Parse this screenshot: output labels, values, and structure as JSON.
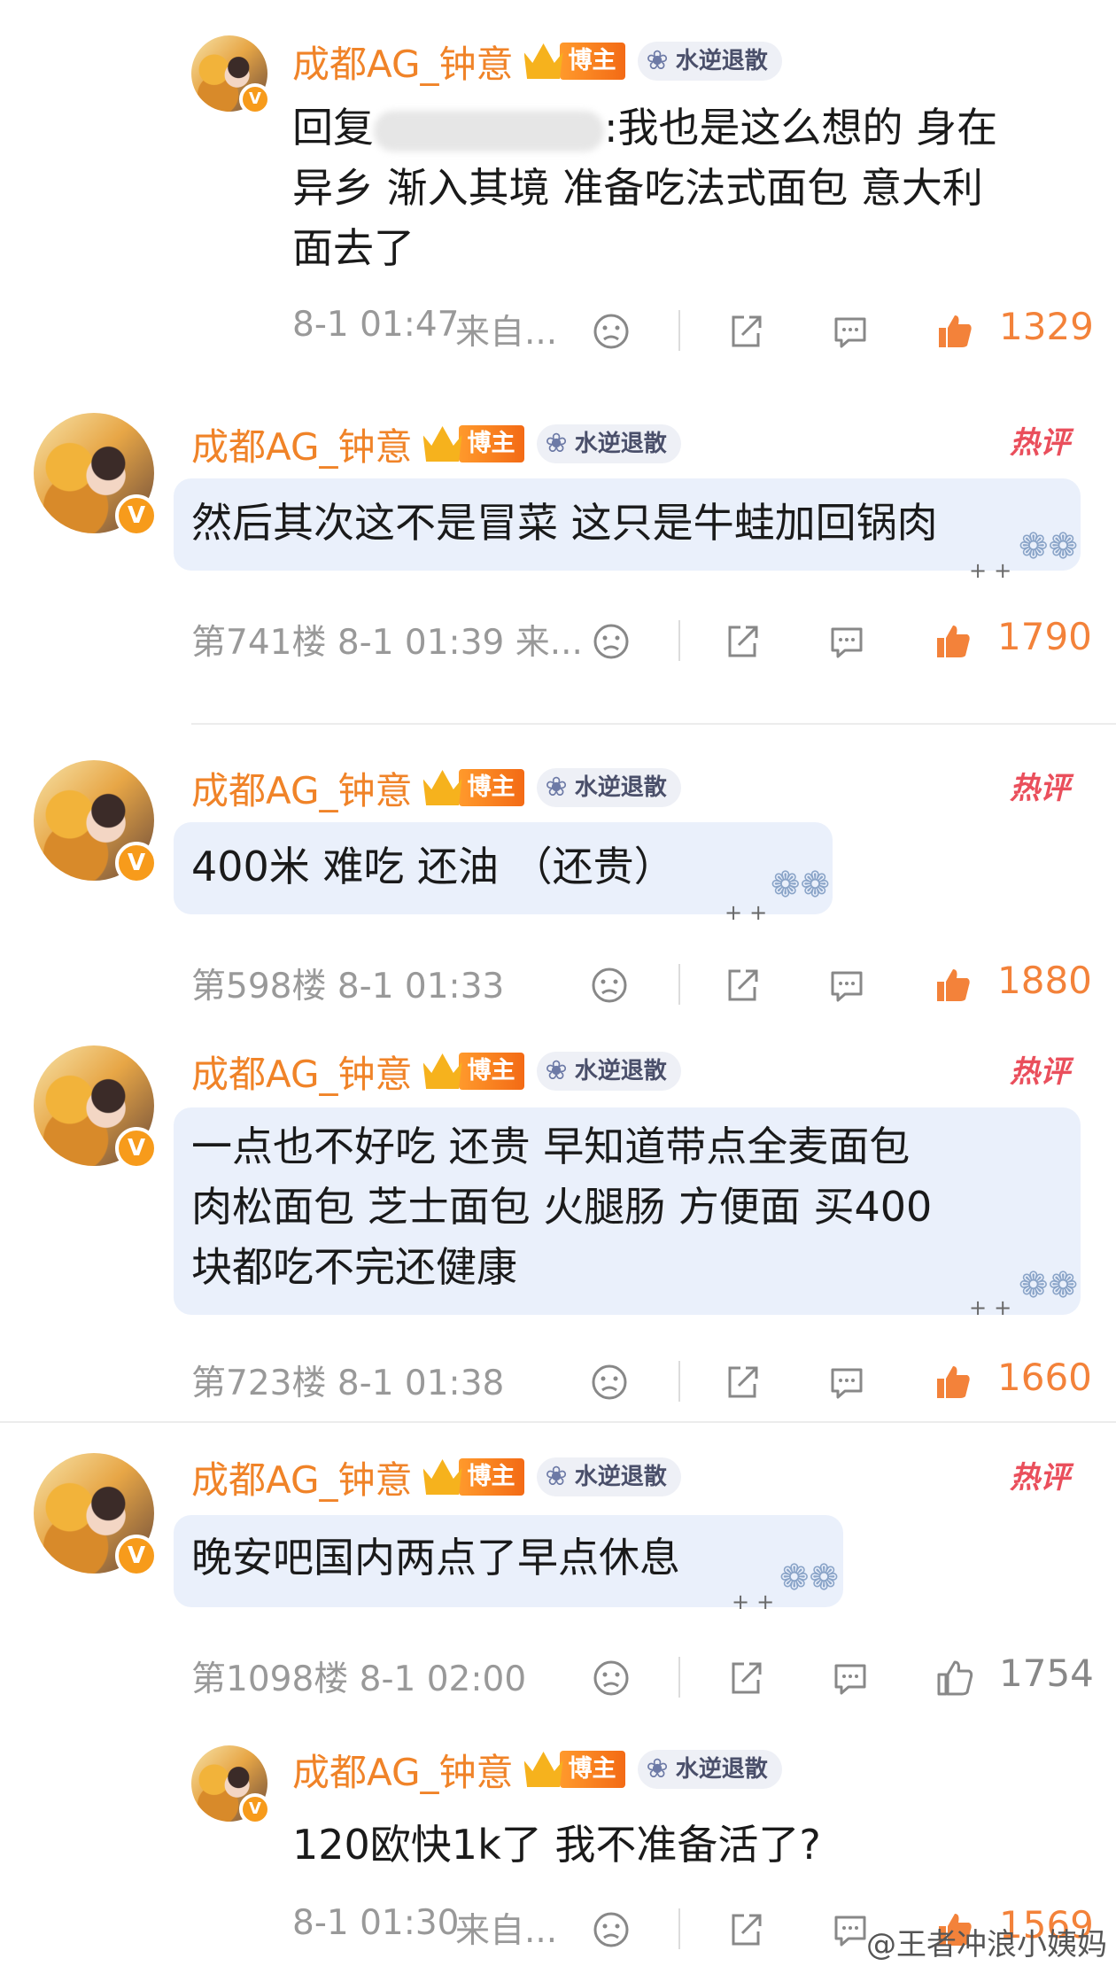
{
  "common": {
    "username": "成都AG_钟意",
    "badge": "博主",
    "fan_badge": "水逆退散",
    "vip": "V",
    "hot_tag": "热评",
    "from_truncated": "来自...",
    "reply_prefix": "回复",
    "watermark": "@王者冲浪小姨妈"
  },
  "comments": [
    {
      "type": "reply",
      "text": ":我也是这么想的 身在\n异乡 渐入其境 准备吃法式面包 意大利\n面去了",
      "timestamp": "8-1 01:47",
      "likes": "1329",
      "liked": true
    },
    {
      "type": "hot",
      "text": "然后其次这不是冒菜 这只是牛蛙加回锅肉",
      "floor_meta": "第741楼 8-1 01:39 来...",
      "likes": "1790",
      "liked": true
    },
    {
      "type": "hot",
      "text": "400米 难吃 还油 （还贵）",
      "floor_meta": "第598楼 8-1 01:33",
      "likes": "1880",
      "liked": true
    },
    {
      "type": "hot",
      "text": "一点也不好吃 还贵 早知道带点全麦面包\n肉松面包 芝士面包 火腿肠 方便面 买400\n块都吃不完还健康",
      "floor_meta": "第723楼 8-1 01:38",
      "likes": "1660",
      "liked": true
    },
    {
      "type": "hot",
      "text": "晚安吧国内两点了早点休息",
      "floor_meta": "第1098楼 8-1 02:00",
      "likes": "1754",
      "liked": false
    },
    {
      "type": "reply",
      "text": "120欧快1k了 我不准备活了?",
      "timestamp": "8-1 01:30",
      "likes": "1569",
      "liked": true
    }
  ],
  "icons": {
    "dislike": "dislike-face-icon",
    "share": "share-icon",
    "comment": "comment-icon",
    "like": "thumbs-up-icon",
    "rose": "rose-sticker-icon"
  },
  "colors": {
    "username": "#f08328",
    "like_active": "#f3823a",
    "hot": "#ea4f5c",
    "bubble": "#eaf0fb"
  }
}
